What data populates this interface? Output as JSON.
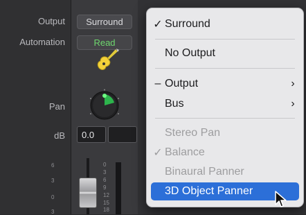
{
  "labels": {
    "output": "Output",
    "automation": "Automation",
    "pan": "Pan",
    "db": "dB"
  },
  "strip": {
    "output_value": "Surround",
    "automation_value": "Read",
    "db_value": "0.0",
    "fader_scale": [
      "6",
      "3",
      "0",
      "3"
    ],
    "meter_scale": [
      "0",
      "3",
      "6",
      "9",
      "12",
      "15",
      "18"
    ]
  },
  "menu": {
    "items": [
      {
        "label": "Surround",
        "check": "✓",
        "arrow": ""
      },
      {
        "label": "No Output",
        "check": "",
        "arrow": ""
      },
      {
        "label": "Output",
        "check": "–",
        "arrow": "›"
      },
      {
        "label": "Bus",
        "check": "",
        "arrow": "›"
      },
      {
        "label": "Stereo Pan",
        "check": "",
        "arrow": ""
      },
      {
        "label": "Balance",
        "check": "✓",
        "arrow": ""
      },
      {
        "label": "Binaural Panner",
        "check": "",
        "arrow": ""
      },
      {
        "label": "3D Object Panner",
        "check": "",
        "arrow": ""
      }
    ]
  },
  "colors": {
    "automation_read": "#6ed86e",
    "menu_highlight": "#2c6fd8",
    "pan_green": "#2ecc52"
  },
  "icons": {
    "track_icon": "electric-guitar-icon",
    "pan_knob": "pan-knob-icon",
    "cursor": "mouse-pointer-icon"
  }
}
